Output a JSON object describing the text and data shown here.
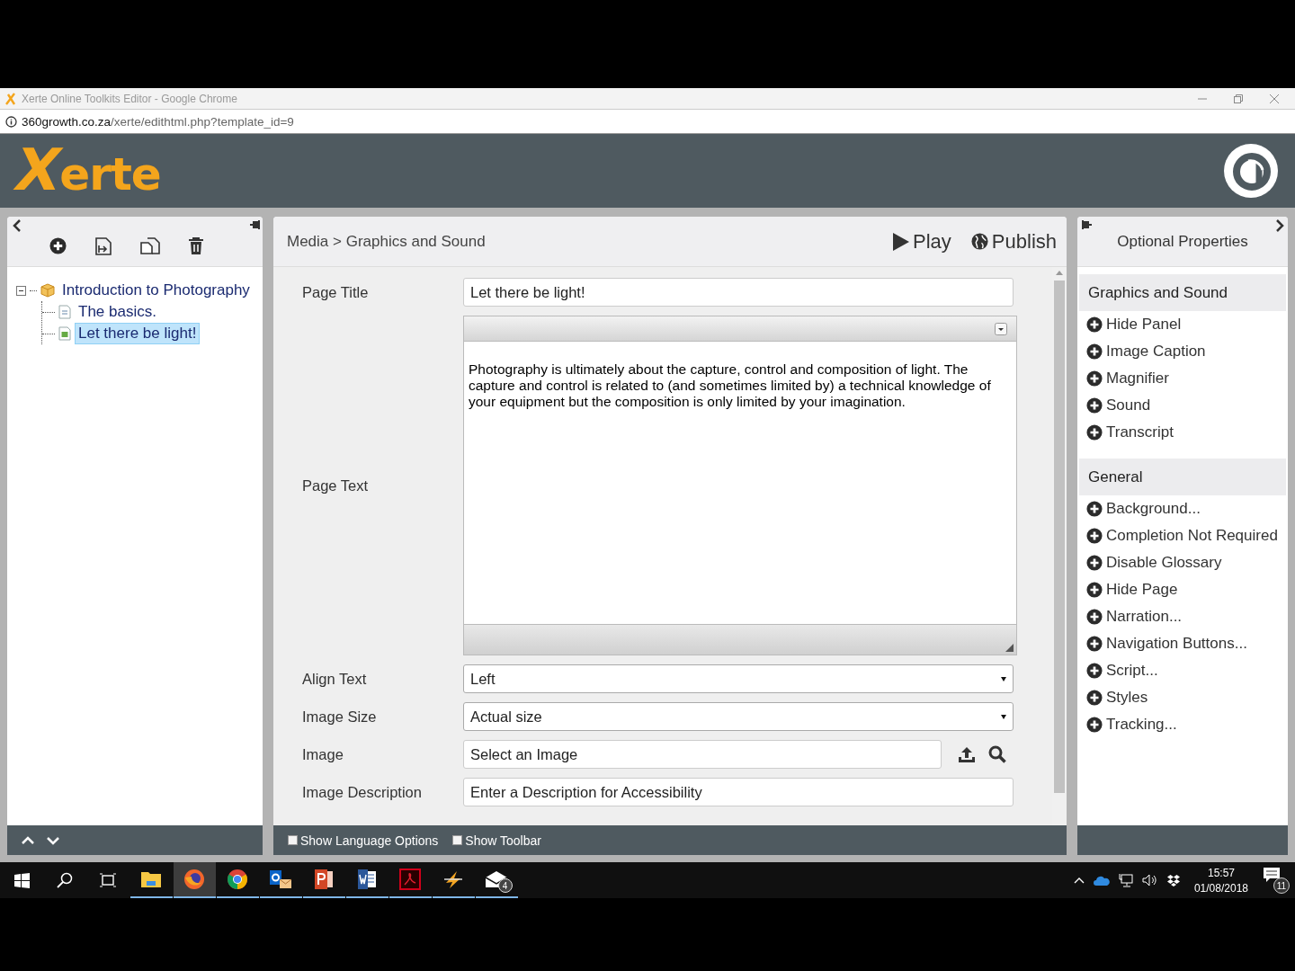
{
  "window": {
    "title": "Xerte Online Toolkits Editor - Google Chrome",
    "url_host": "360growth.co.za",
    "url_path": "/xerte/edithtml.php?template_id=9"
  },
  "header": {
    "logo_initial": "X",
    "logo_rest": "erte"
  },
  "tree": [
    {
      "label": "Introduction to Photography",
      "kind": "project",
      "expanded": true,
      "selected": false,
      "children": [
        {
          "label": "The basics.",
          "kind": "text-page",
          "selected": false
        },
        {
          "label": "Let there be light!",
          "kind": "media-page",
          "selected": true
        }
      ]
    }
  ],
  "editor": {
    "breadcrumb": "Media > Graphics and Sound",
    "play": "Play",
    "publish": "Publish",
    "fields": [
      {
        "kind": "text",
        "label": "Page Title",
        "value": "Let there be light!"
      },
      {
        "kind": "richtext",
        "label": "Page Text",
        "value": "Photography is ultimately about the capture, control and composition of light. The capture and control is related to (and sometimes limited by) a technical knowledge of your equipment but the composition is only limited by your imagination."
      },
      {
        "kind": "select",
        "label": "Align Text",
        "value": "Left"
      },
      {
        "kind": "select",
        "label": "Image Size",
        "value": "Actual size"
      },
      {
        "kind": "image",
        "label": "Image",
        "value": "Select an Image"
      },
      {
        "kind": "text",
        "label": "Image Description",
        "value": "Enter a Description for Accessibility"
      }
    ],
    "options": [
      {
        "label": "Show Language Options",
        "checked": false
      },
      {
        "label": "Show Toolbar",
        "checked": false
      }
    ]
  },
  "optional": {
    "title": "Optional Properties",
    "groups": [
      {
        "title": "Graphics and Sound",
        "items": [
          "Hide Panel",
          "Image Caption",
          "Magnifier",
          "Sound",
          "Transcript"
        ]
      },
      {
        "title": "General",
        "items": [
          "Background...",
          "Completion Not Required",
          "Disable Glossary",
          "Hide Page",
          "Narration...",
          "Navigation Buttons...",
          "Script...",
          "Styles",
          "Tracking..."
        ]
      }
    ]
  },
  "taskbar": {
    "apps": [
      {
        "kind": "folder",
        "active": false
      },
      {
        "kind": "firefox",
        "active": true
      },
      {
        "kind": "chrome",
        "active": false
      },
      {
        "kind": "outlook",
        "active": false
      },
      {
        "kind": "powerpoint",
        "active": false
      },
      {
        "kind": "word",
        "active": false
      },
      {
        "kind": "pdf",
        "active": false
      },
      {
        "kind": "bolt",
        "active": false
      },
      {
        "kind": "mail",
        "active": false,
        "badge": "4"
      }
    ],
    "time": "15:57",
    "date": "01/08/2018",
    "notifications": "11"
  }
}
